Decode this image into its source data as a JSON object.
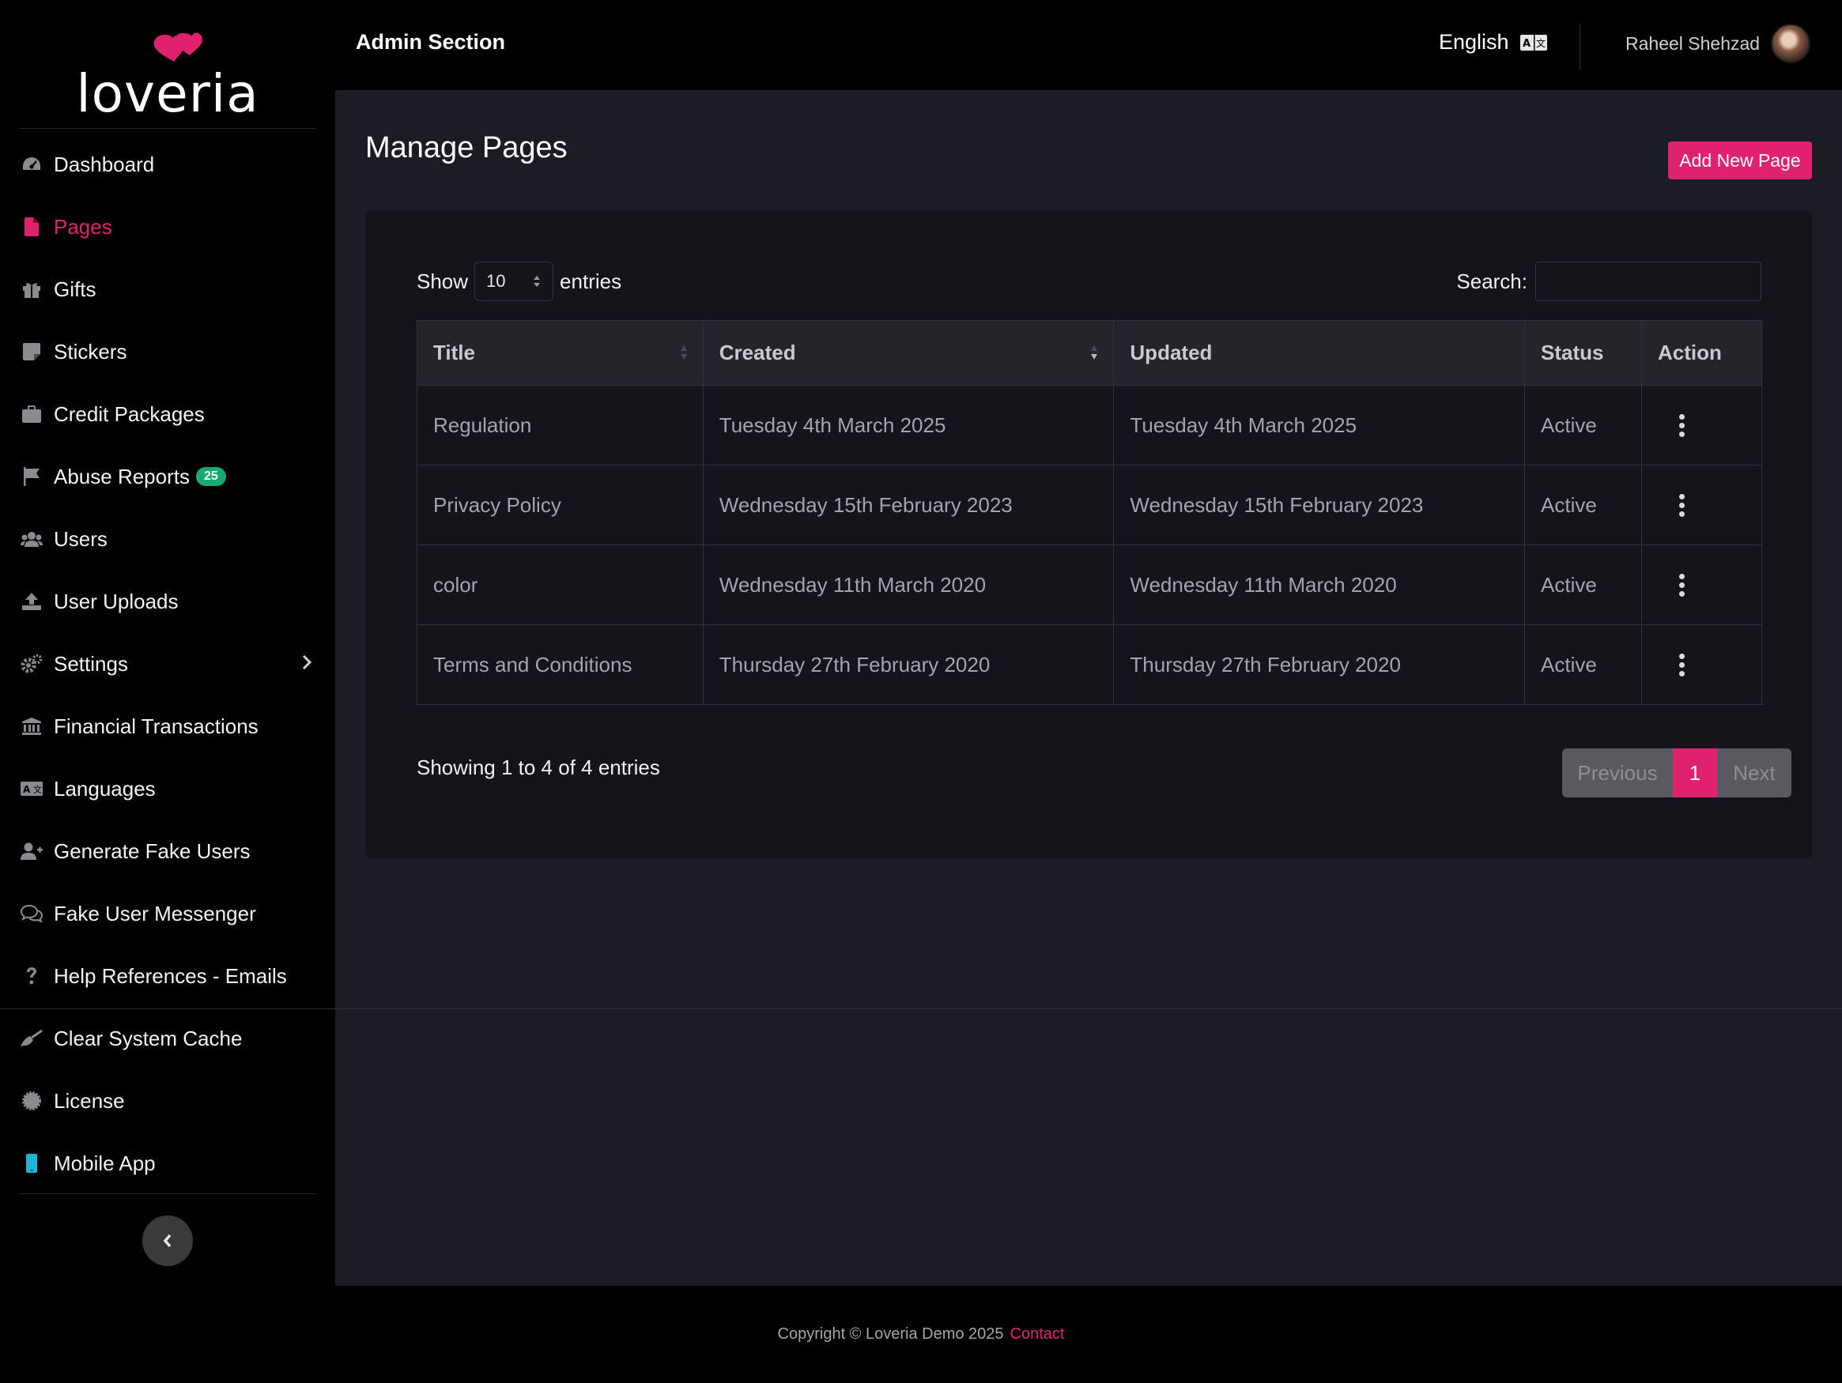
{
  "brand": {
    "name": "loveria",
    "accent": "#e0226e"
  },
  "sidebar": {
    "items": [
      {
        "label": "Dashboard",
        "icon": "dashboard-gauge-icon"
      },
      {
        "label": "Pages",
        "icon": "file-icon",
        "active": true
      },
      {
        "label": "Gifts",
        "icon": "gift-icon"
      },
      {
        "label": "Stickers",
        "icon": "sticky-note-icon"
      },
      {
        "label": "Credit Packages",
        "icon": "briefcase-icon"
      },
      {
        "label": "Abuse Reports",
        "icon": "flag-icon",
        "badge": "25"
      },
      {
        "label": "Users",
        "icon": "users-icon"
      },
      {
        "label": "User Uploads",
        "icon": "upload-icon"
      },
      {
        "label": "Settings",
        "icon": "cogs-icon",
        "has_submenu": true
      },
      {
        "label": "Financial Transactions",
        "icon": "bank-icon"
      },
      {
        "label": "Languages",
        "icon": "language-icon"
      },
      {
        "label": "Generate Fake Users",
        "icon": "user-plus-icon"
      },
      {
        "label": "Fake User Messenger",
        "icon": "comments-icon"
      },
      {
        "label": "Help References - Emails",
        "icon": "question-icon"
      },
      {
        "label": "Clear System Cache",
        "icon": "broom-icon"
      },
      {
        "label": "License",
        "icon": "certificate-icon"
      },
      {
        "label": "Mobile App",
        "icon": "mobile-icon"
      }
    ]
  },
  "topbar": {
    "title": "Admin Section",
    "language": "English",
    "user_name": "Raheel Shehzad"
  },
  "main": {
    "page_title": "Manage Pages",
    "add_button": "Add New Page",
    "show_label": "Show",
    "entries_count": "10",
    "entries_label": "entries",
    "search_label": "Search:",
    "search_value": "",
    "table": {
      "headers": [
        "Title",
        "Created",
        "Updated",
        "Status",
        "Action"
      ],
      "rows": [
        {
          "title": "Regulation",
          "created": "Tuesday 4th March 2025",
          "updated": "Tuesday 4th March 2025",
          "status": "Active"
        },
        {
          "title": "Privacy Policy",
          "created": "Wednesday 15th February 2023",
          "updated": "Wednesday 15th February 2023",
          "status": "Active"
        },
        {
          "title": "color",
          "created": "Wednesday 11th March 2020",
          "updated": "Wednesday 11th March 2020",
          "status": "Active"
        },
        {
          "title": "Terms and Conditions",
          "created": "Thursday 27th February 2020",
          "updated": "Thursday 27th February 2020",
          "status": "Active"
        }
      ]
    },
    "info": "Showing 1 to 4 of 4 entries",
    "pager": {
      "previous": "Previous",
      "current": "1",
      "next": "Next"
    }
  },
  "footer": {
    "copyright": "Copyright © Loveria Demo 2025",
    "contact": "Contact"
  }
}
